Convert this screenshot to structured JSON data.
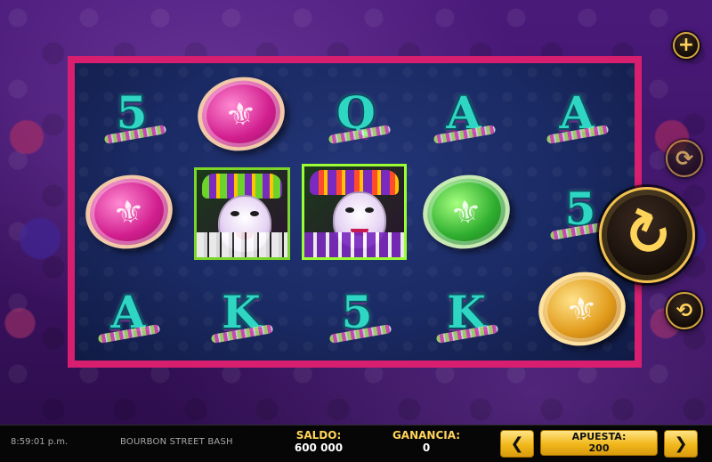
{
  "game": {
    "reels": [
      [
        "5",
        "pink-coin",
        "A"
      ],
      [
        "pink-coin",
        "jester-man",
        "K"
      ],
      [
        "Q",
        "jester-woman",
        "5"
      ],
      [
        "A",
        "green-coin",
        "K"
      ],
      [
        "A",
        "5",
        "gold-coin"
      ]
    ],
    "symbols": {
      "r1c1": "5",
      "r1c3": "Q",
      "r1c4": "A",
      "r1c5": "A",
      "r2c5": "5",
      "r3c1": "A",
      "r3c2": "K",
      "r3c3": "5",
      "r3c4": "K"
    },
    "coin_glyph": "⚜"
  },
  "controls": {
    "plus_glyph": "+",
    "auto_glyph": "⟳",
    "spin_glyph": "↻",
    "quick_glyph": "⟲"
  },
  "statusbar": {
    "clock": "8:59:01 p.m.",
    "title": "BOURBON STREET BASH",
    "saldo_label": "SALDO:",
    "saldo_value": "600 000",
    "ganancia_label": "GANANCIA:",
    "ganancia_value": "0",
    "apuesta_label": "APUESTA:",
    "apuesta_value": "200",
    "prev_glyph": "❮",
    "next_glyph": "❯"
  },
  "colors": {
    "frame_pink": "#d81f6f",
    "frame_yellow": "#ffc400",
    "letter": "#2fd6c3",
    "button_gold": "#f1b81b"
  }
}
